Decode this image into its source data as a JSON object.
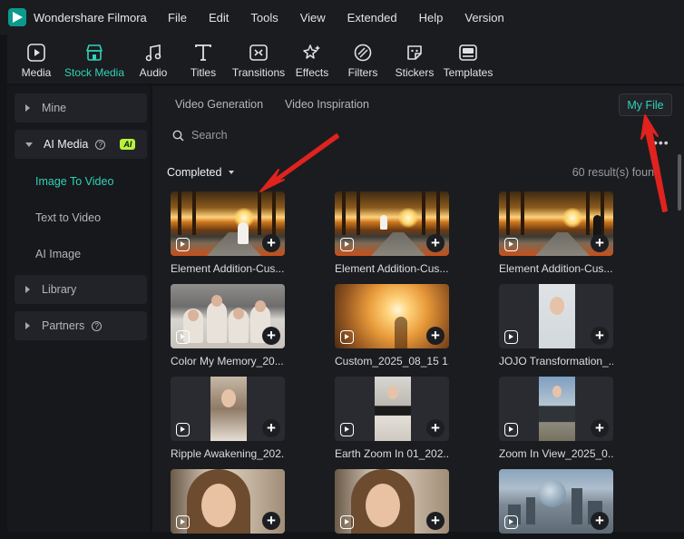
{
  "app": {
    "title": "Wondershare Filmora"
  },
  "menu": [
    "File",
    "Edit",
    "Tools",
    "View",
    "Extended",
    "Help",
    "Version"
  ],
  "toolbar": [
    {
      "label": "Media",
      "icon": "media-icon",
      "active": false
    },
    {
      "label": "Stock Media",
      "icon": "stock-media-icon",
      "active": true
    },
    {
      "label": "Audio",
      "icon": "audio-icon",
      "active": false
    },
    {
      "label": "Titles",
      "icon": "titles-icon",
      "active": false
    },
    {
      "label": "Transitions",
      "icon": "transitions-icon",
      "active": false
    },
    {
      "label": "Effects",
      "icon": "effects-icon",
      "active": false
    },
    {
      "label": "Filters",
      "icon": "filters-icon",
      "active": false
    },
    {
      "label": "Stickers",
      "icon": "stickers-icon",
      "active": false
    },
    {
      "label": "Templates",
      "icon": "templates-icon",
      "active": false
    }
  ],
  "sidebar": {
    "mine": "Mine",
    "ai_media": "AI Media",
    "ai_badge": "AI",
    "ai_items": [
      "Image To Video",
      "Text to Video",
      "AI Image"
    ],
    "library": "Library",
    "partners": "Partners"
  },
  "main": {
    "tabs": [
      "Video Generation",
      "Video Inspiration"
    ],
    "my_file": "My File",
    "search_placeholder": "Search",
    "filter_label": "Completed",
    "result_count": "60 result(s) found"
  },
  "cards": [
    {
      "name": "Element Addition-Cus...",
      "thumb": "autumn"
    },
    {
      "name": "Element Addition-Cus...",
      "thumb": "autumn"
    },
    {
      "name": "Element Addition-Cus...",
      "thumb": "autumn"
    },
    {
      "name": "Color My Memory_20...",
      "thumb": "family"
    },
    {
      "name": "Custom_2025_08_15 1...",
      "thumb": "sunset"
    },
    {
      "name": "JOJO Transformation_...",
      "thumb": "jojo"
    },
    {
      "name": "Ripple Awakening_202...",
      "thumb": "ripple"
    },
    {
      "name": "Earth Zoom In 01_202...",
      "thumb": "earth"
    },
    {
      "name": "Zoom In View_2025_0...",
      "thumb": "zoom"
    },
    {
      "name": "",
      "thumb": "closeup"
    },
    {
      "name": "",
      "thumb": "closeup"
    },
    {
      "name": "",
      "thumb": "city"
    }
  ],
  "colors": {
    "accent": "#2ed3b7",
    "annotation": "#e0231e",
    "ai_badge": "#b6f23c"
  }
}
